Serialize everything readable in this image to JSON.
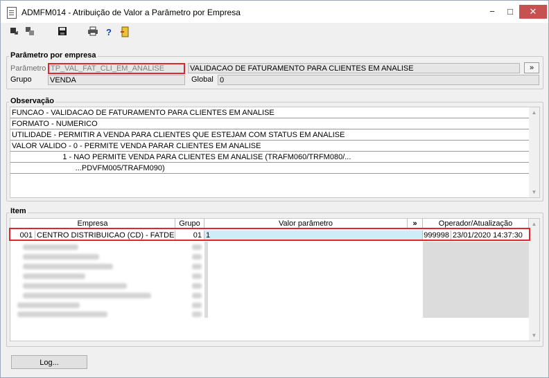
{
  "window": {
    "title": "ADMFM014 - Atribuição de Valor a Parâmetro por Empresa",
    "minimize_label": "−",
    "maximize_label": "□",
    "close_label": "✕"
  },
  "toolbar": {
    "icons": [
      "goto-first-icon",
      "copy-icon",
      "save-icon",
      "print-icon",
      "help-icon",
      "exit-door-icon"
    ],
    "help_label": "?"
  },
  "parametro_por_empresa": {
    "section_title": "Parâmetro por empresa",
    "parametro_label": "Parâmetro",
    "parametro_value": "TP_VAL_FAT_CLI_EM_ANALISE",
    "parametro_desc": "VALIDACAO DE FATURAMENTO PARA CLIENTES EM ANALISE",
    "more_button_label": "»",
    "grupo_label": "Grupo",
    "grupo_value": "VENDA",
    "global_label": "Global",
    "global_value": "0"
  },
  "observacao": {
    "section_title": "Observação",
    "lines": [
      "FUNCAO - VALIDACAO DE FATURAMENTO PARA CLIENTES EM ANALISE",
      "FORMATO - NUMERICO",
      "UTILIDADE - PERMITIR A VENDA PARA CLIENTES QUE ESTEJAM COM STATUS EM ANALISE",
      "VALOR VALIDO - 0 - PERMITE VENDA PARAR CLIENTES EM ANALISE",
      "                        1 - NAO PERMITE VENDA PARA CLIENTES EM ANALISE (TRAFM060/TRFM080/...",
      "                              ...PDVFM005/TRAFM090)"
    ]
  },
  "item": {
    "section_title": "Item",
    "headers": {
      "empresa": "Empresa",
      "grupo": "Grupo",
      "valor": "Valor parâmetro",
      "more": "»",
      "operador": "Operador/Atualização"
    },
    "selected_row": {
      "code": "001",
      "empresa": "CENTRO DISTRIBUICAO (CD) - FATDES",
      "grupo": "01",
      "valor": "1",
      "operador": "999998",
      "atualizacao": "23/01/2020 14:37:30"
    }
  },
  "footer": {
    "log_button_label": "Log..."
  }
}
